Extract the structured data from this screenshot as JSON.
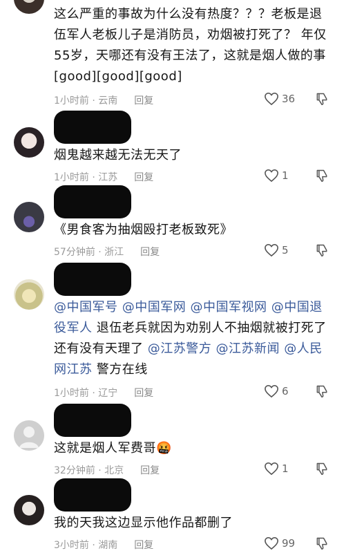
{
  "comments": [
    {
      "text": "这么严重的事故为什么没有热度？？？老板是退伍军人老板儿子是消防员，劝烟被打死了？ 年仅55岁，天哪还有没有王法了，这就是烟人做的事[good][good][good]",
      "meta": "1小时前 · 云南",
      "reply": "回复",
      "likes": "36"
    },
    {
      "text": "烟鬼越来越无法无天了",
      "meta": "1小时前 · 江苏",
      "reply": "回复",
      "likes": "1"
    },
    {
      "text": "《男食客为抽烟殴打老板致死》",
      "meta": "57分钟前 · 浙江",
      "reply": "回复",
      "likes": "5"
    },
    {
      "mentions_a": [
        "@中国军号",
        "@中国军网",
        "@中国军视网",
        "@中国退役军人"
      ],
      "body": "退伍老兵就因为劝别人不抽烟就被打死了 还有没有天理了",
      "mentions_b": [
        "@江苏警方",
        "@江苏新闻",
        "@人民网江苏"
      ],
      "tail": "警方在线",
      "meta": "1小时前 · 辽宁",
      "reply": "回复",
      "likes": "6"
    },
    {
      "text": "这就是烟人军费哥",
      "emoji": "🤬",
      "meta": "32分钟前 · 北京",
      "reply": "回复",
      "likes": "1"
    },
    {
      "text": "我的天我这边显示他作品都删了",
      "meta": "3小时前 · 湖南",
      "reply": "回复",
      "likes": "99"
    }
  ],
  "icons": {
    "like": "heart-outline-icon",
    "dislike": "thumbs-down-outline-icon"
  }
}
